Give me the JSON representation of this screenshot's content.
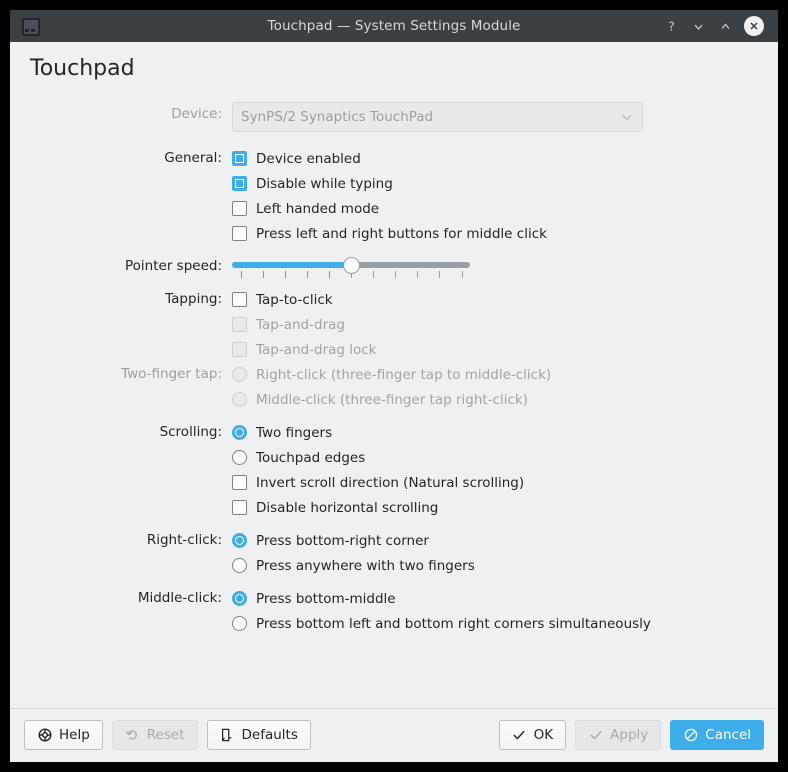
{
  "window": {
    "title": "Touchpad — System Settings Module",
    "icon": "touchpad-icon",
    "controls": {
      "help": "?",
      "minimize": "∨",
      "maximize": "∧",
      "close": "×"
    },
    "accent_color": "#3daee9",
    "titlebar_color": "#3b4045",
    "background_color": "#eff0f1"
  },
  "page": {
    "title": "Touchpad"
  },
  "device": {
    "label": "Device:",
    "value": "SynPS/2 Synaptics TouchPad",
    "disabled": true,
    "options": [
      "SynPS/2 Synaptics TouchPad"
    ]
  },
  "general": {
    "label": "General:",
    "items": [
      {
        "label": "Device enabled",
        "checked": true,
        "disabled": false
      },
      {
        "label": "Disable while typing",
        "checked": true,
        "disabled": false
      },
      {
        "label": "Left handed mode",
        "checked": false,
        "disabled": false
      },
      {
        "label": "Press left and right buttons for middle click",
        "checked": false,
        "disabled": false
      }
    ]
  },
  "pointer_speed": {
    "label": "Pointer speed:",
    "value": 5,
    "min": 0,
    "max": 10,
    "tick_count": 11
  },
  "tapping": {
    "label": "Tapping:",
    "items": [
      {
        "label": "Tap-to-click",
        "checked": false,
        "disabled": false
      },
      {
        "label": "Tap-and-drag",
        "checked": false,
        "disabled": true
      },
      {
        "label": "Tap-and-drag lock",
        "checked": false,
        "disabled": true
      }
    ]
  },
  "two_finger_tap": {
    "label": "Two-finger tap:",
    "disabled": true,
    "items": [
      {
        "label": "Right-click (three-finger tap to middle-click)",
        "selected": false,
        "disabled": true
      },
      {
        "label": "Middle-click (three-finger tap right-click)",
        "selected": false,
        "disabled": true
      }
    ]
  },
  "scrolling": {
    "label": "Scrolling:",
    "radios": [
      {
        "label": "Two fingers",
        "selected": true,
        "disabled": false
      },
      {
        "label": "Touchpad edges",
        "selected": false,
        "disabled": false
      }
    ],
    "checks": [
      {
        "label": "Invert scroll direction (Natural scrolling)",
        "checked": false,
        "disabled": false
      },
      {
        "label": "Disable horizontal scrolling",
        "checked": false,
        "disabled": false
      }
    ]
  },
  "right_click": {
    "label": "Right-click:",
    "items": [
      {
        "label": "Press bottom-right corner",
        "selected": true,
        "disabled": false
      },
      {
        "label": "Press anywhere with two fingers",
        "selected": false,
        "disabled": false
      }
    ]
  },
  "middle_click": {
    "label": "Middle-click:",
    "items": [
      {
        "label": "Press bottom-middle",
        "selected": true,
        "disabled": false
      },
      {
        "label": "Press bottom left and bottom right corners simultaneously",
        "selected": false,
        "disabled": false
      }
    ]
  },
  "buttons": {
    "help": {
      "label": "Help",
      "icon": "lifebuoy-icon",
      "disabled": false
    },
    "reset": {
      "label": "Reset",
      "icon": "undo-icon",
      "disabled": true
    },
    "defaults": {
      "label": "Defaults",
      "icon": "document-revert-icon",
      "disabled": false
    },
    "ok": {
      "label": "OK",
      "icon": "check-icon",
      "disabled": false
    },
    "apply": {
      "label": "Apply",
      "icon": "check-icon",
      "disabled": true
    },
    "cancel": {
      "label": "Cancel",
      "icon": "no-entry-icon",
      "disabled": false,
      "primary": true
    }
  }
}
